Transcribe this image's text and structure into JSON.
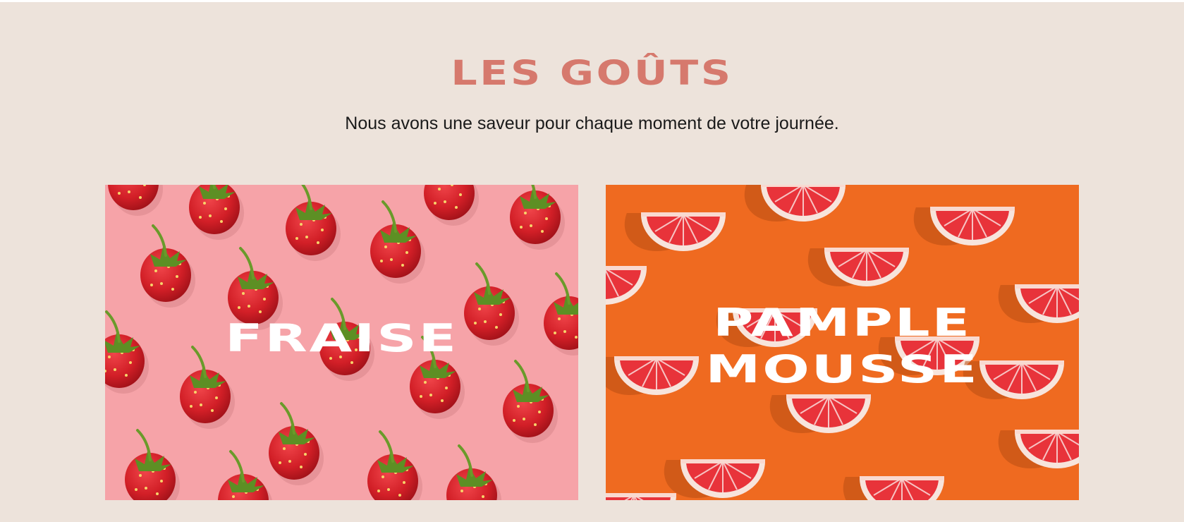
{
  "section": {
    "title": "LES GOÛTS",
    "subtitle": "Nous avons une saveur pour chaque moment de votre journée."
  },
  "flavors": [
    {
      "label": "FRAISE",
      "image": "strawberries-pattern",
      "background_color": "#f6a3a8",
      "fruit_color": "#d21f27",
      "stem_color": "#6a9a2a"
    },
    {
      "label_line1": "PAMPLE",
      "label_line2": "MOUSSE",
      "image": "grapefruit-slices-pattern",
      "background_color": "#ef6a20",
      "fruit_color": "#e8333a",
      "rind_color": "#f7e4dc"
    }
  ],
  "colors": {
    "page_background": "#ede3db",
    "title_accent": "#d6796d",
    "subtitle_text": "#1a1a1a",
    "card_text": "#ffffff"
  }
}
